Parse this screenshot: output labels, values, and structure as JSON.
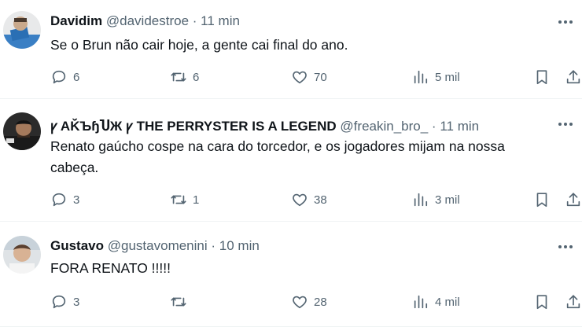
{
  "tweets": [
    {
      "name": "Davidim",
      "handle": "@davidestroe",
      "time": "11 min",
      "text": "Se o Brun não cair hoje, a gente cai final do ano.",
      "replies": "6",
      "retweets": "6",
      "likes": "70",
      "views": "5 mil"
    },
    {
      "name": "ꝩ AḰ̌ЪɧႮЖ ꝩ THE PERRYSTER IS A LEGEND",
      "handle": "@freakin_bro_",
      "time": "11 min",
      "text": "Renato gaúcho cospe na cara do torcedor, e os jogadores mijam na nossa cabeça.",
      "replies": "3",
      "retweets": "1",
      "likes": "38",
      "views": "3 mil"
    },
    {
      "name": "Gustavo",
      "handle": "@gustavomenini",
      "time": "10 min",
      "text": "FORA RENATO !!!!!",
      "replies": "3",
      "retweets": "",
      "likes": "28",
      "views": "4 mil"
    }
  ],
  "separator": "·",
  "icons": {
    "more": "more-options-icon",
    "reply": "reply-icon",
    "retweet": "retweet-icon",
    "like": "heart-icon",
    "views": "views-icon",
    "bookmark": "bookmark-icon",
    "share": "share-icon"
  },
  "colors": {
    "text": "#0f1419",
    "secondary": "#536471",
    "divider": "#eff3f4"
  }
}
